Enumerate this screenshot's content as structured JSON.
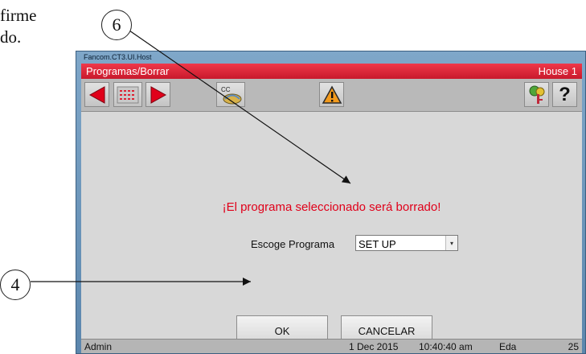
{
  "document": {
    "line1": "firme",
    "line2": "do."
  },
  "callouts": {
    "c6": "6",
    "c4": "4"
  },
  "window": {
    "app_title": "Fancom.CT3.UI.Host",
    "breadcrumb": "Programas/Borrar",
    "house": "House 1"
  },
  "toolbar": {
    "buttons": [
      {
        "icon": "prev-arrow-icon"
      },
      {
        "icon": "list-icon"
      },
      {
        "icon": "next-arrow-icon"
      },
      {
        "icon": "cc-icon",
        "label": "CC"
      },
      {
        "icon": "warning-icon"
      },
      {
        "icon": "key-icon"
      },
      {
        "icon": "help-icon",
        "label": "?"
      }
    ]
  },
  "dialog": {
    "warning_text": "¡El programa seleccionado será borrado!",
    "select_label": "Escoge Programa",
    "select_value": "SET UP",
    "ok_label": "OK",
    "cancel_label": "CANCELAR"
  },
  "status": {
    "user": "Admin",
    "date": "1 Dec 2015",
    "time": "10:40:40 am",
    "mode": "Eda",
    "page": "25"
  },
  "colors": {
    "titlebar": "#d8202f",
    "warning_text": "#e0001a",
    "arrow_red": "#e0001a"
  }
}
